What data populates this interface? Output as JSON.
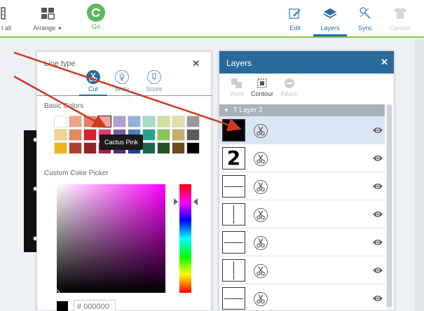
{
  "toolbar": {
    "select_all_label": "t all",
    "arrange_label": "Arrange",
    "go_label": "Go",
    "edit_label": "Edit",
    "layers_label": "Layers",
    "sync_label": "Sync",
    "canvas_label": "Canvas",
    "accent": "#8bc34a"
  },
  "line_type": {
    "title": "Line type",
    "tabs": [
      {
        "label": "Cut",
        "icon": "scissors-icon"
      },
      {
        "label": "Write",
        "icon": "pen-icon"
      },
      {
        "label": "Score",
        "icon": "score-icon"
      }
    ],
    "active_tab": "Cut",
    "basic_colors_label": "Basic Colors",
    "swatches": [
      "#ffffff",
      "#e8a583",
      "#e47d6d",
      "#f2a5a4",
      "#b49bd1",
      "#8fb3da",
      "#a7d9c5",
      "#cfe29d",
      "#e3dcae",
      "#999999",
      "#f3d48e",
      "#e8855b",
      "#d9212f",
      "#e53c76",
      "#7b5aa8",
      "#4f80c1",
      "#21a48e",
      "#8ac356",
      "#c9ad6a",
      "#5b5b5b",
      "#eeb51c",
      "#b0412c",
      "#8e2327",
      "#b11a56",
      "#4a2e7c",
      "#223e8a",
      "#1b6651",
      "#255327",
      "#70491c",
      "#000000"
    ],
    "selected_swatch_index": 3,
    "tooltip": "Cactus Pink",
    "custom_picker_label": "Custom Color Picker",
    "hex_placeholder": "# 000000",
    "current_color": "#000000"
  },
  "layers": {
    "title": "Layers",
    "actions": [
      {
        "label": "Weld",
        "enabled": false
      },
      {
        "label": "Contour",
        "enabled": true
      },
      {
        "label": "Attach",
        "enabled": false
      }
    ],
    "group_name": "T Layer 2",
    "rows": [
      {
        "thumb": "black-square",
        "selected": true
      },
      {
        "thumb": "2",
        "selected": false
      },
      {
        "thumb": "hline",
        "selected": false
      },
      {
        "thumb": "vline",
        "selected": false
      },
      {
        "thumb": "hline",
        "selected": false
      },
      {
        "thumb": "vline",
        "selected": false
      },
      {
        "thumb": "hline",
        "selected": false
      }
    ]
  },
  "colors": {
    "panel_header": "#2a6a9b",
    "annotation_arrow": "#cc3a1c"
  }
}
